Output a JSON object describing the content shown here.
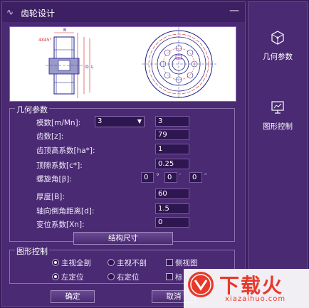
{
  "window": {
    "title": "齿轮设计",
    "minimize": "—"
  },
  "geometry": {
    "title": "几何参数",
    "module_label": "模数[m/Mn]:",
    "module_select": "3",
    "module_value": "3",
    "teeth_label": "齿数[z]:",
    "teeth_value": "79",
    "addendum_label": "齿顶高系数[ha*]:",
    "addendum_value": "1",
    "clearance_label": "顶隙系数[c*]:",
    "clearance_value": "0.25",
    "helix_label": "螺旋角[β]:",
    "helix_deg": "0",
    "helix_deg_unit": "°",
    "helix_min": "0",
    "helix_min_unit": "′",
    "helix_sec": "0",
    "helix_sec_unit": "″",
    "thickness_label": "厚度[B]:",
    "thickness_value": "60",
    "chamfer_label": "轴向倒角距离[d]:",
    "chamfer_value": "1.5",
    "shift_label": "变位系数[Xn]:",
    "shift_value": "0",
    "structure_button": "结构尺寸"
  },
  "graphics": {
    "title": "图形控制",
    "main_full": "主视全剖",
    "main_none": "主视不剖",
    "side_view": "侧视图",
    "left_pos": "左定位",
    "right_pos": "右定位",
    "mark": "标"
  },
  "footer": {
    "ok": "确定",
    "cancel": "取消"
  },
  "sidebar": {
    "geometry": "几何参数",
    "graphics": "图形控制"
  },
  "preview_labels": {
    "chamfer": "4X45°",
    "dim_b": "B",
    "dim_d": "D",
    "dim_l": "L"
  },
  "watermark": {
    "text": "下载火",
    "sub": "xiazaihuo.com"
  },
  "colors": {
    "accent": "#4a2a72",
    "dark": "#3a1e5c",
    "preview_line": "#d02020"
  }
}
